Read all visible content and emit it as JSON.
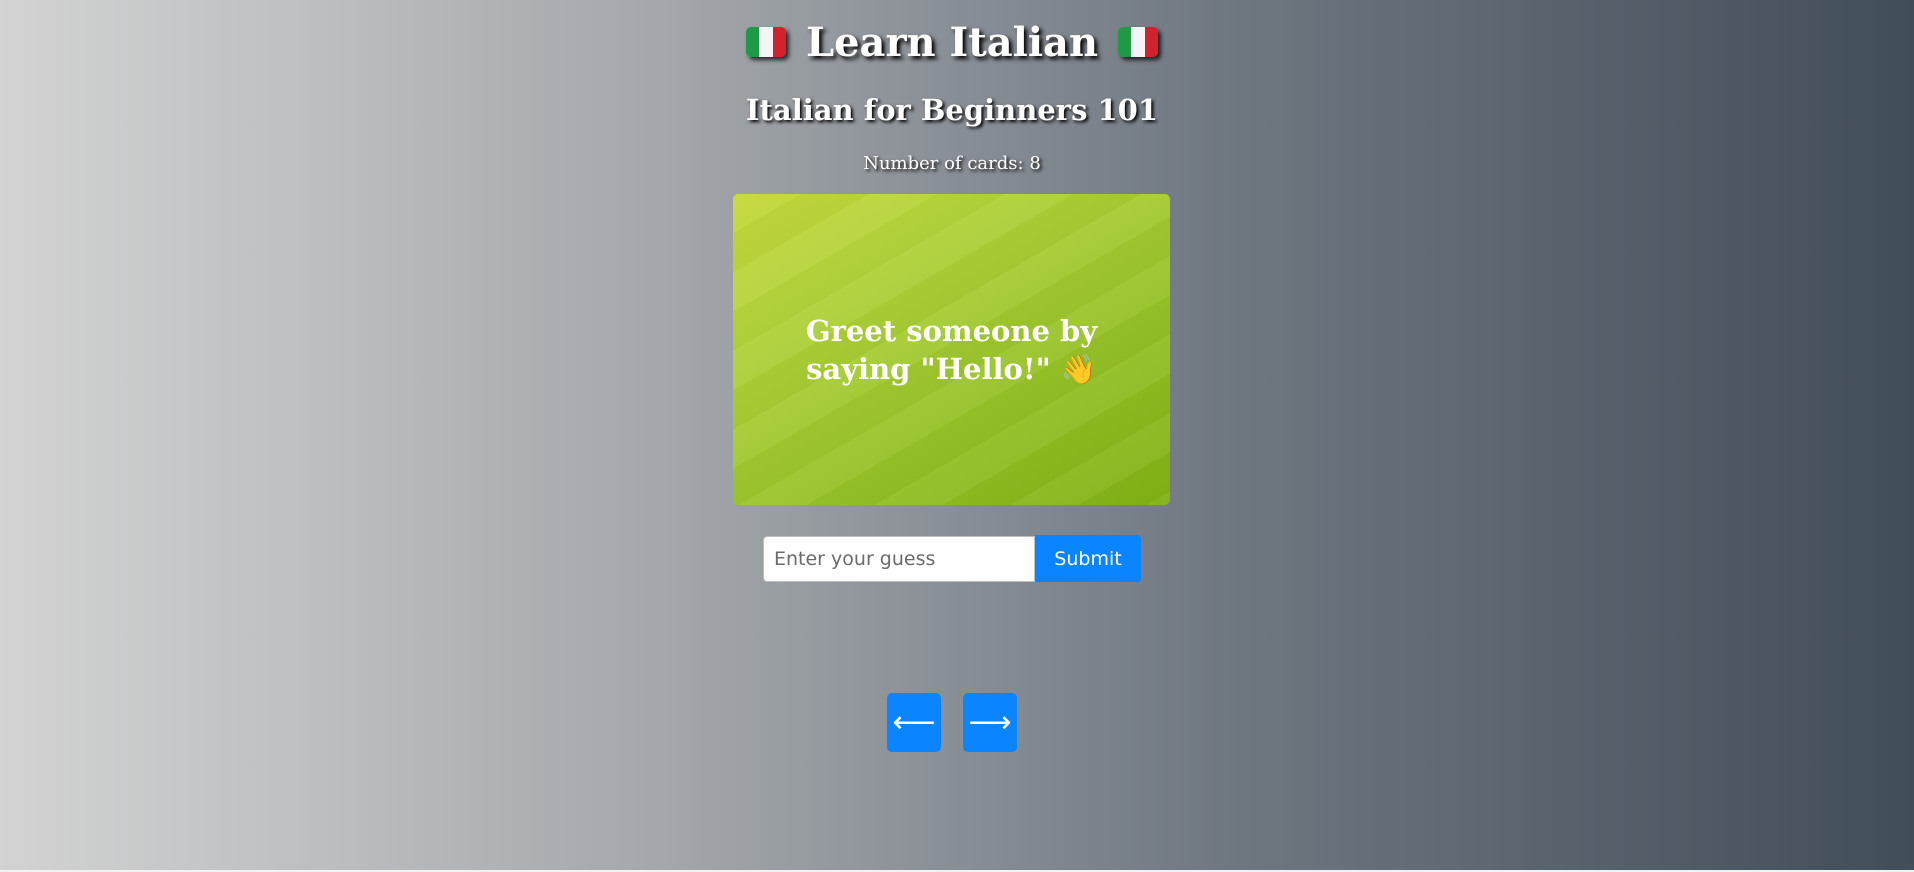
{
  "header": {
    "title": "Learn Italian",
    "flag_icon": "italian-flag-icon",
    "flag_colors": [
      "#1e9a46",
      "#f5f5f5",
      "#d2222d"
    ]
  },
  "deck": {
    "name": "Italian for Beginners 101",
    "count_label": "Number of cards: 8"
  },
  "card": {
    "text": "Greet someone by saying \"Hello!\" 👋",
    "colors": [
      "#c6d73a",
      "#7fb013"
    ]
  },
  "guess": {
    "placeholder": "Enter your guess",
    "value": "",
    "submit_label": "Submit"
  },
  "navigation": {
    "prev_icon": "left-arrow-icon",
    "prev_glyph": "⟵",
    "next_icon": "right-arrow-icon",
    "next_glyph": "⟶"
  },
  "theme": {
    "accent": "#0a84ff",
    "background_start": "#d3d3d3",
    "background_end": "#414d59"
  }
}
